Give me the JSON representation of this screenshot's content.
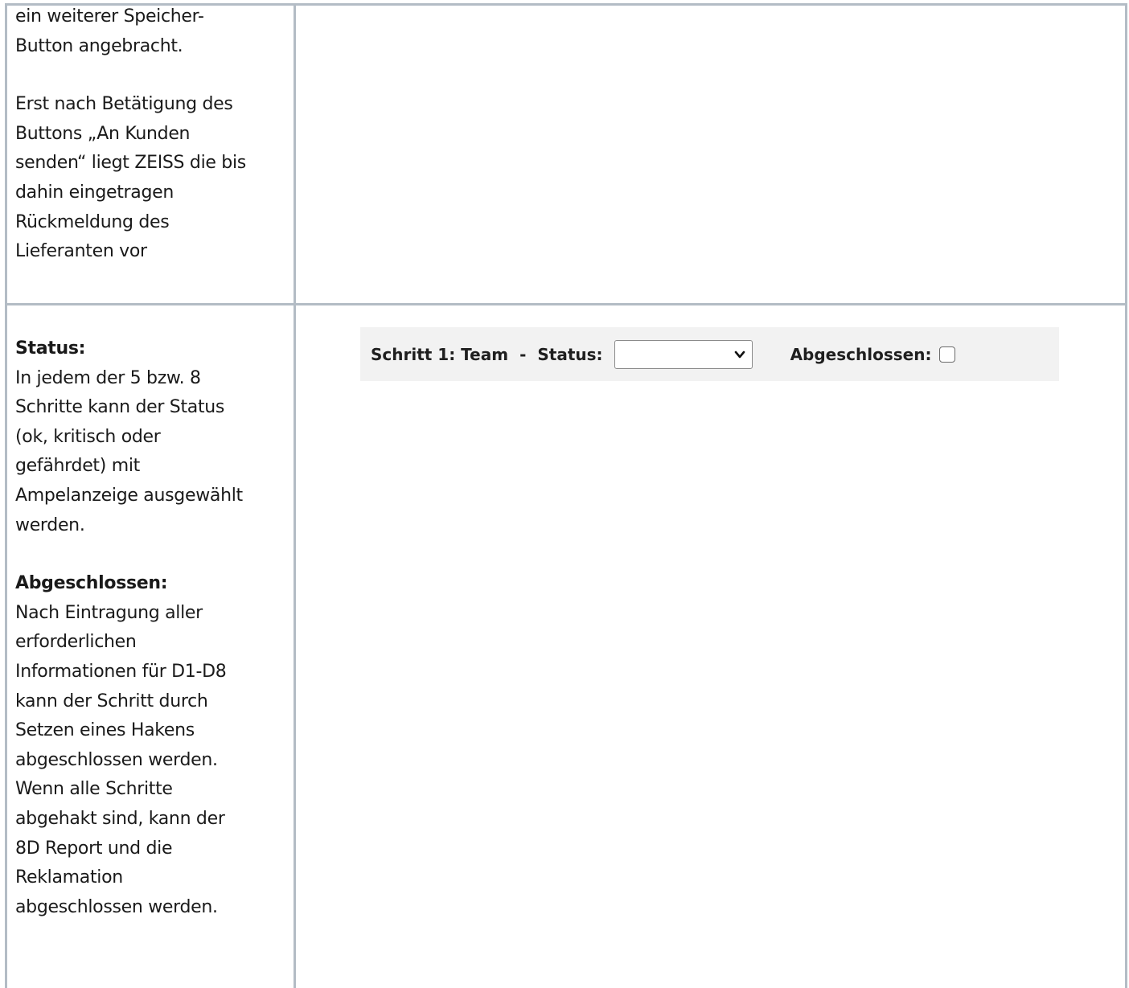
{
  "row1": {
    "lines_a": [
      "ein weiterer Speicher-",
      "Button angebracht."
    ],
    "lines_b": [
      "Erst nach Betätigung des",
      "Buttons „An Kunden",
      "senden“ liegt ZEISS die bis",
      "dahin eingetragen",
      "Rückmeldung des",
      "Lieferanten vor"
    ]
  },
  "row2": {
    "status_heading": "Status:",
    "status_lines": [
      "In jedem der 5 bzw. 8",
      "Schritte kann der Status",
      "(ok, kritisch oder",
      "gefährdet) mit",
      "Ampelanzeige ausgewählt",
      "werden."
    ],
    "done_heading": "Abgeschlossen:",
    "done_lines": [
      "Nach Eintragung aller",
      "erforderlichen",
      "Informationen für D1-D8",
      "kann der Schritt durch",
      "Setzen eines Hakens",
      "abgeschlossen werden.",
      "Wenn alle Schritte",
      "abgehakt sind, kann der",
      "8D Report und die",
      "Reklamation",
      "abgeschlossen werden."
    ]
  },
  "toolbar": {
    "step_label": "Schritt 1: Team",
    "separator": "-",
    "status_label": "Status:",
    "status_value": "",
    "done_label": "Abgeschlossen:",
    "done_checked": false
  }
}
